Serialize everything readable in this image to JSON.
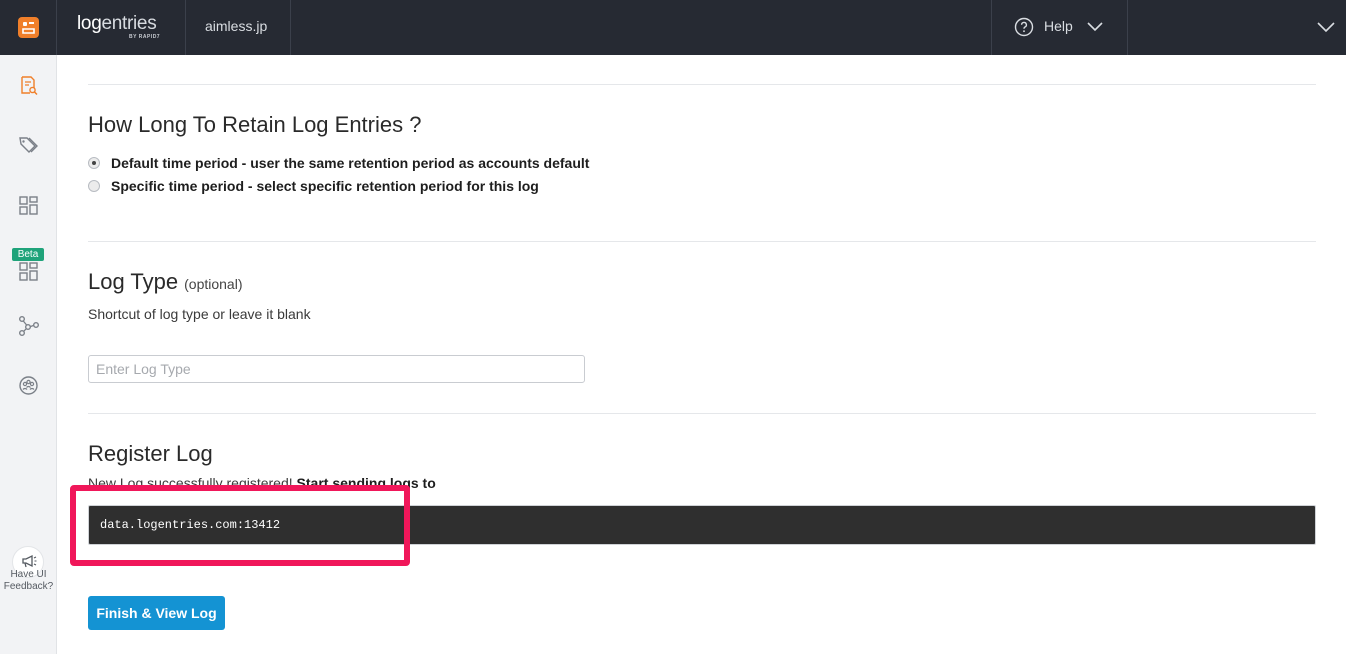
{
  "topbar": {
    "brand_main": "log",
    "brand_rest": "entries",
    "brand_sub": "BY RAPID7",
    "account_name": "aimless.jp",
    "help_label": "Help",
    "icons": [
      "app-logo-icon",
      "help-circle-icon",
      "chevron-down-icon",
      "user-menu-chevron-icon"
    ]
  },
  "sidebar": {
    "icons": [
      "log-search-icon",
      "tags-icon",
      "dashboards-icon",
      "beta-dashboards-icon",
      "workflow-icon",
      "community-icon"
    ],
    "beta_label": "Beta",
    "feedback_label": "Have UI Feedback?",
    "feedback_line1": "Have UI",
    "feedback_line2": "Feedback?"
  },
  "retention": {
    "title": "How Long To Retain Log Entries ?",
    "options": [
      {
        "label": "Default time period - user the same retention period as accounts default",
        "checked": true
      },
      {
        "label": "Specific time period - select specific retention period for this log",
        "checked": false
      }
    ]
  },
  "log_type": {
    "title": "Log Type",
    "optional": "(optional)",
    "help": "Shortcut of log type or leave it blank",
    "placeholder": "Enter Log Type",
    "value": ""
  },
  "register": {
    "title": "Register Log",
    "message_prefix": "New Log successfully registered!",
    "message_bold": "Start sending logs to",
    "endpoint": "data.logentries.com:13412",
    "finish_button": "Finish & View Log"
  },
  "colors": {
    "topbar": "#262a33",
    "accent_orange": "#f07f2a",
    "primary_button": "#1493d3",
    "beta_badge": "#1fa37a",
    "highlight": "#f0175a",
    "endpoint_bg": "#2f2f2f"
  }
}
